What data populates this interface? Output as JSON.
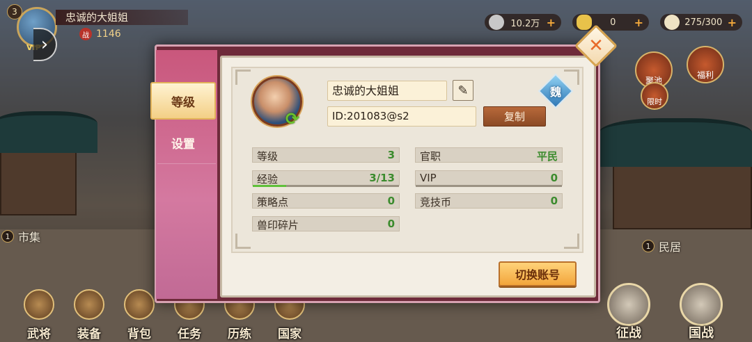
{
  "hud": {
    "player_level": "3",
    "player_name": "忠诚的大姐姐",
    "vip_label": "VIP",
    "power_icon_char": "战",
    "power": "1146",
    "silver": "10.2万",
    "gold": "0",
    "stamina": "275/300"
  },
  "map": {
    "market_count": "1",
    "market_label": "市集",
    "residence_count": "1",
    "residence_label": "民居",
    "pool_label": "聚池",
    "limited_label": "限时",
    "welfare_label": "福利"
  },
  "bottom_nav": {
    "generals": "武将",
    "equipment": "装备",
    "bag": "背包",
    "quests": "任务",
    "training": "历练",
    "nation": "国家",
    "expedition": "征战",
    "national_war": "国战"
  },
  "dialog": {
    "tabs": {
      "level": "等级",
      "settings": "设置"
    },
    "player_name": "忠诚的大姐姐",
    "player_id": "ID:201083@s2",
    "copy_label": "复制",
    "faction": "魏",
    "stats": {
      "level_key": "等级",
      "level_val": "3",
      "title_key": "官职",
      "title_val": "平民",
      "exp_key": "经验",
      "exp_val": "3/13",
      "vip_key": "VIP",
      "vip_val": "0",
      "strategy_key": "策略点",
      "strategy_val": "0",
      "arena_key": "竞技币",
      "arena_val": "0",
      "seal_key": "兽印碎片",
      "seal_val": "0"
    },
    "exp_progress": 0.23,
    "vip_progress": 0,
    "switch_label": "切换账号",
    "close_char": "✕",
    "edit_char": "✎"
  },
  "colors": {
    "sidebar": "#c9577c",
    "accent": "#f2a53b",
    "value_green": "#3b8b2d"
  }
}
